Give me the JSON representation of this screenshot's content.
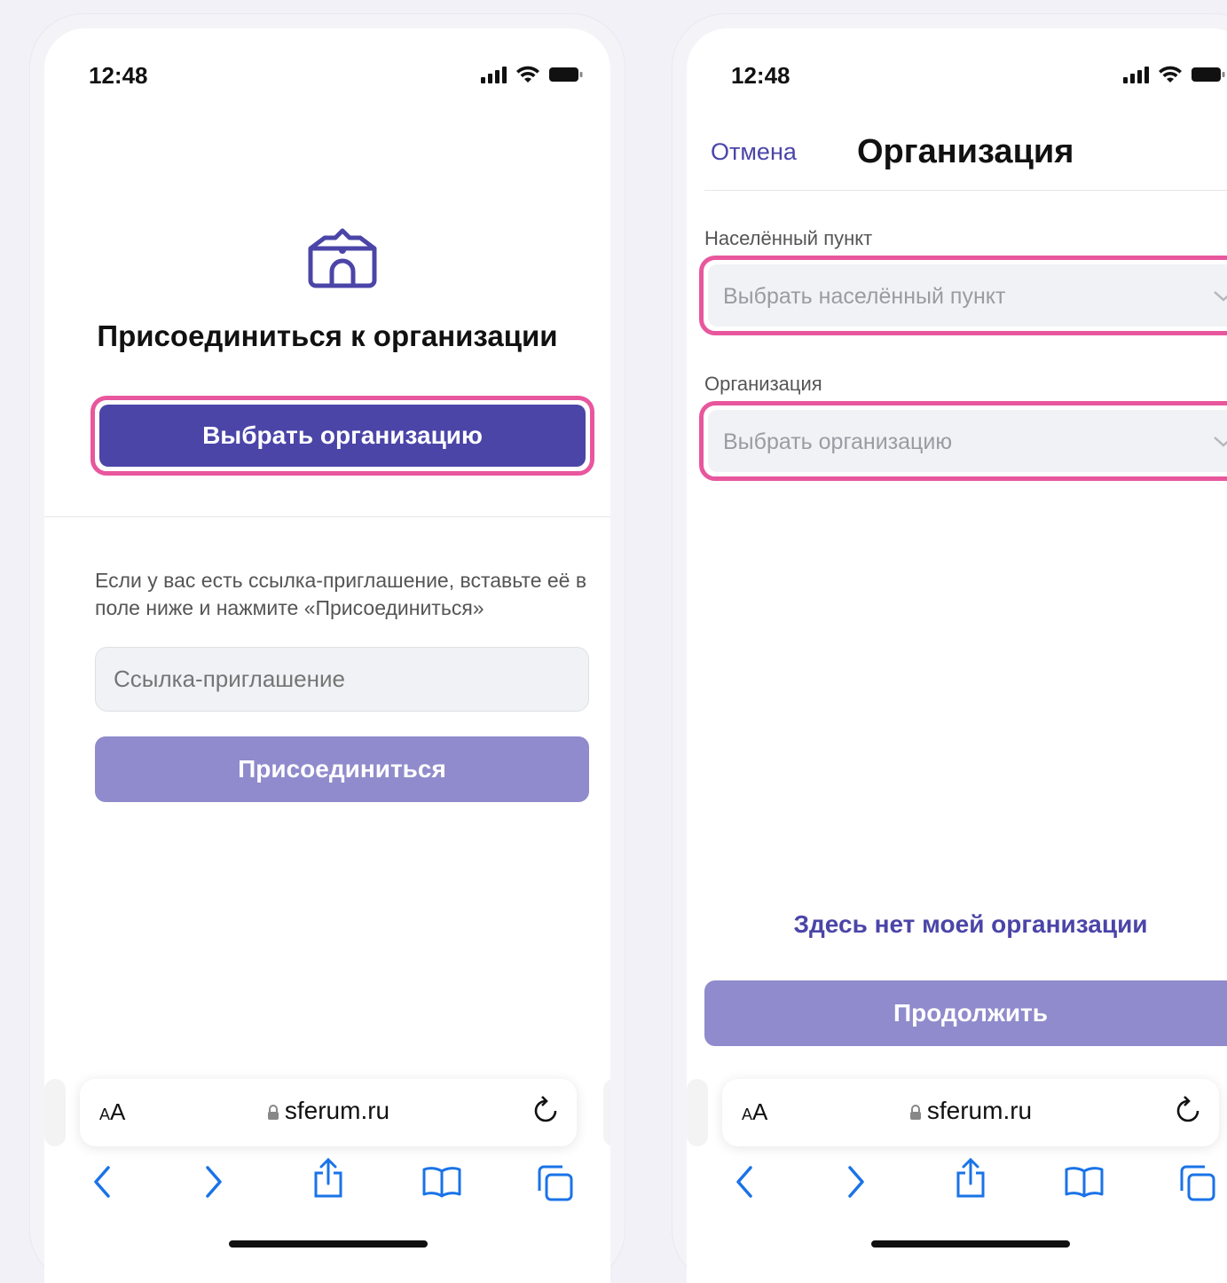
{
  "status": {
    "time": "12:48"
  },
  "screen1": {
    "title": "Присоединиться к организации",
    "select_org_button": "Выбрать организацию",
    "hint": "Если у вас есть ссылка-приглашение, вставьте её в поле ниже и нажмите «Присоединиться»",
    "invite_placeholder": "Ссылка-приглашение",
    "join_button": "Присоединиться"
  },
  "screen2": {
    "cancel": "Отмена",
    "title": "Организация",
    "city_label": "Населённый пункт",
    "city_placeholder": "Выбрать населённый пункт",
    "org_label": "Организация",
    "org_placeholder": "Выбрать организацию",
    "no_org_link": "Здесь нет моей организации",
    "continue_button": "Продолжить"
  },
  "browser": {
    "text_size_small": "A",
    "text_size_large": "A",
    "url": "sferum.ru"
  },
  "colors": {
    "primary": "#4b45a8",
    "primary_disabled": "#8f8bcc",
    "highlight": "#e8579d",
    "safari_blue": "#1a73e8"
  }
}
